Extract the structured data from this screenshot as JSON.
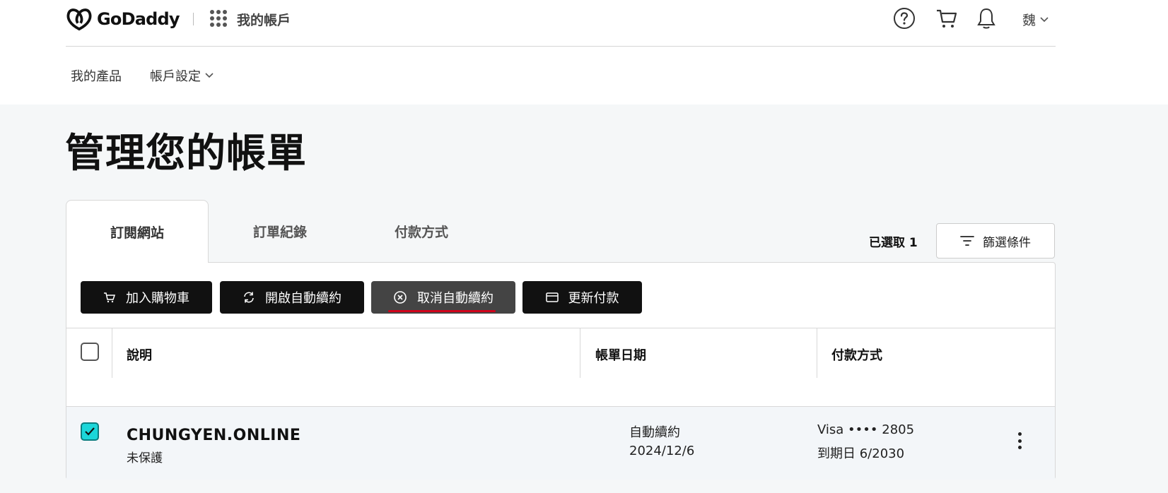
{
  "header": {
    "brand": "GoDaddy",
    "account_label": "我的帳戶",
    "user_initial": "魏"
  },
  "subnav": {
    "products": "我的產品",
    "account_settings": "帳戶設定"
  },
  "page": {
    "title": "管理您的帳單"
  },
  "tabs": [
    {
      "label": "訂閱網站",
      "active": true
    },
    {
      "label": "訂單紀錄",
      "active": false
    },
    {
      "label": "付款方式",
      "active": false
    }
  ],
  "toolbar": {
    "selected_label": "已選取 1",
    "filter_label": "篩選條件"
  },
  "actions": {
    "add_to_cart": "加入購物車",
    "enable_auto_renew": "開啟自動續約",
    "cancel_auto_renew": "取消自動續約",
    "update_payment": "更新付款"
  },
  "table": {
    "columns": [
      "說明",
      "帳單日期",
      "付款方式"
    ],
    "rows": [
      {
        "domain": "CHUNGYEN.ONLINE",
        "protection": "未保護",
        "billing_status": "自動續約",
        "billing_date": "2024/12/6",
        "payment_card": "Visa •••• 2805",
        "payment_expiry": "到期日 6/2030",
        "checked": true
      }
    ]
  },
  "colors": {
    "accent_checkbox": "#1bd6d9",
    "hover_underline": "#d0021b"
  }
}
